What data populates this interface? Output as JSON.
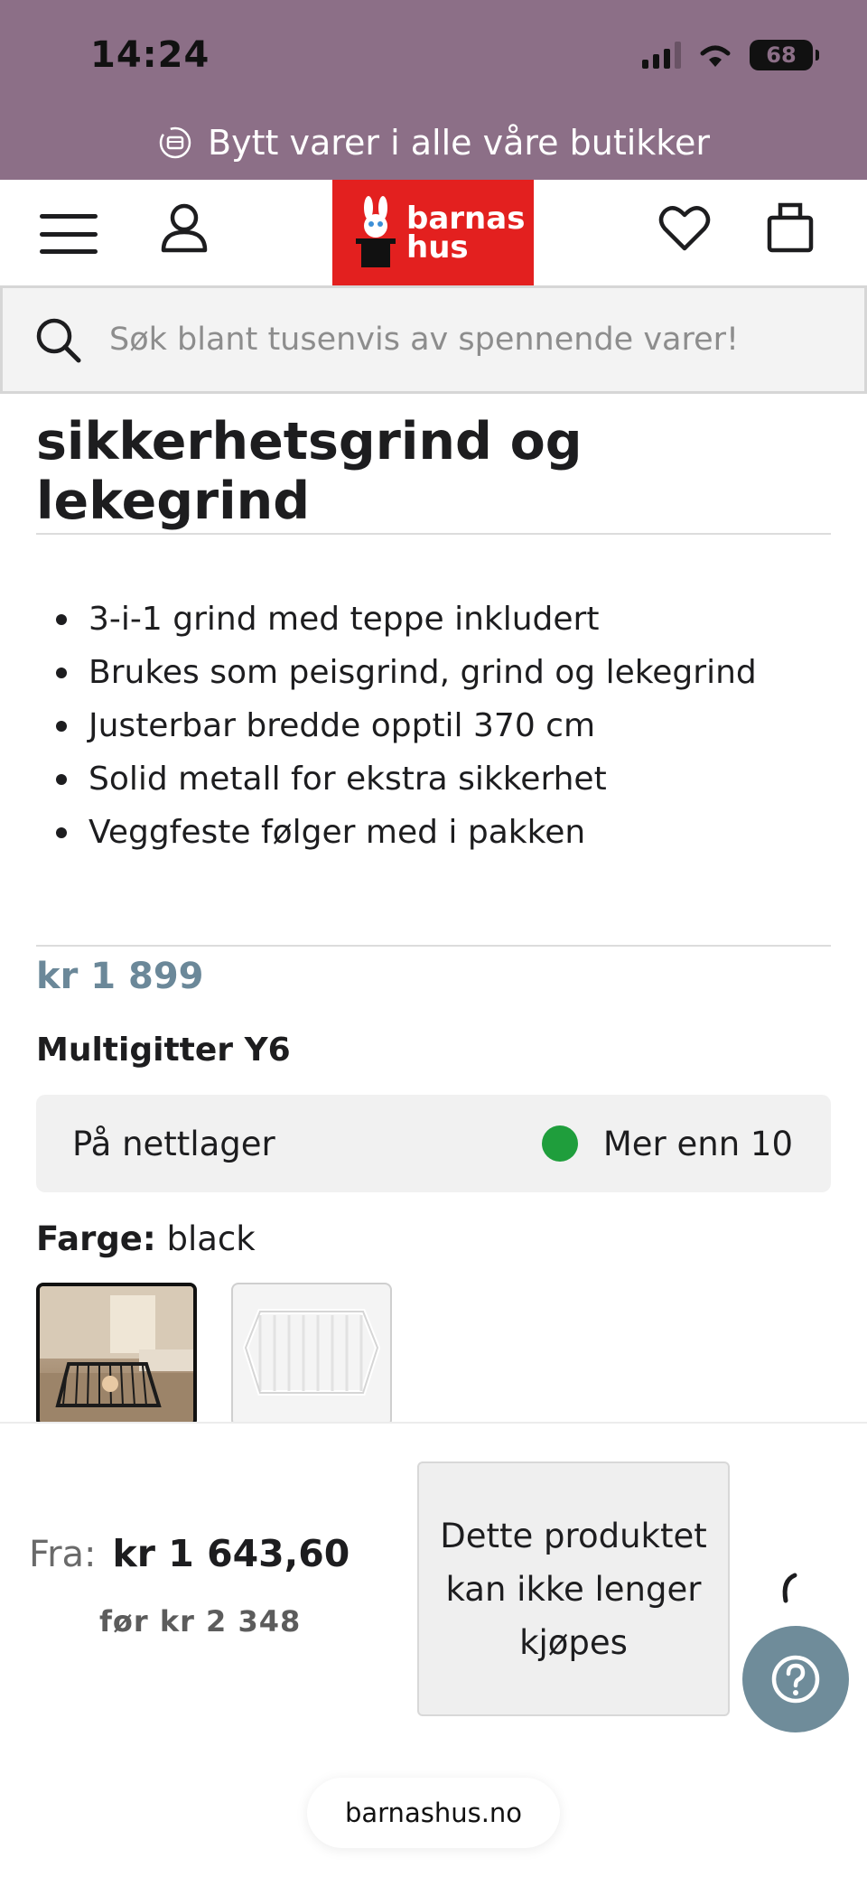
{
  "status_bar": {
    "time": "14:24",
    "battery": "68"
  },
  "banner": {
    "text": "Bytt varer i alle våre butikker"
  },
  "header": {
    "logo_line1": "barnas",
    "logo_line2": "hus"
  },
  "search": {
    "placeholder": "Søk blant tusenvis av spennende varer!"
  },
  "product": {
    "title": "sikkerhetsgrind og lekegrind",
    "bullets": [
      "3-i-1 grind med teppe inkludert",
      "Brukes som peisgrind, grind og lekegrind",
      "Justerbar bredde opptil 370 cm",
      "Solid metall for ekstra sikkerhet",
      "Veggfeste følger med i pakken"
    ],
    "price": "kr 1 899",
    "name": "Multigitter Y6",
    "stock_location": "På nettlager",
    "stock_status": "Mer enn 10",
    "color_label": "Farge:",
    "color_value": "black"
  },
  "bottom_bar": {
    "from_label": "Fra:",
    "from_price": "kr 1 643,60",
    "before_price": "før kr 2 348",
    "unavailable_label": "Dette produktet kan ikke lenger kjøpes"
  },
  "browser": {
    "url": "barnashus.no"
  },
  "colors": {
    "band": "#8c6f87",
    "logo": "#e3201f",
    "price": "#6b8899",
    "stock_dot": "#1f9e3c",
    "help": "#6f8c9a"
  }
}
